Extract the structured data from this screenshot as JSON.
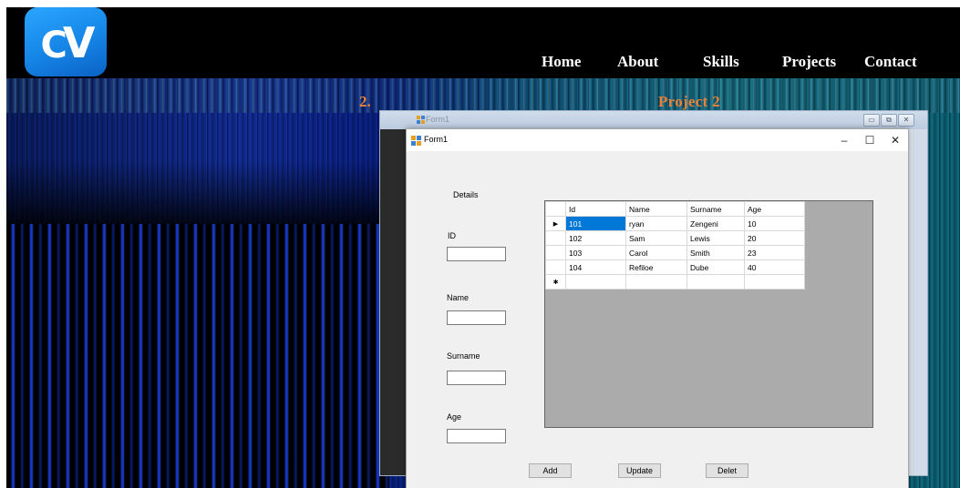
{
  "logo": {
    "letter1": "C",
    "letter2": "V"
  },
  "nav": {
    "home": "Home",
    "about": "About",
    "skills": "Skills",
    "projects": "Projects",
    "contact": "Contact"
  },
  "section": {
    "number": "2.",
    "title": "Project 2"
  },
  "back_window": {
    "title": "Form1"
  },
  "form": {
    "title": "Form1",
    "window_buttons": {
      "minimize": "–",
      "maximize": "☐",
      "close": "✕"
    },
    "details_label": "Details",
    "fields": {
      "id_label": "ID",
      "name_label": "Name",
      "surname_label": "Surname",
      "age_label": "Age"
    },
    "buttons": {
      "add": "Add",
      "update": "Update",
      "delete": "Delet"
    },
    "grid": {
      "columns": [
        "Id",
        "Name",
        "Surname",
        "Age"
      ],
      "rows": [
        [
          "101",
          "ryan",
          "Zengeni",
          "10"
        ],
        [
          "102",
          "Sam",
          "Lewis",
          "20"
        ],
        [
          "103",
          "Carol",
          "Smith",
          "23"
        ],
        [
          "104",
          "Refiloe",
          "Dube",
          "40"
        ]
      ],
      "current_row_marker": "▶",
      "new_row_marker": "✱"
    }
  },
  "colors": {
    "accent_orange": "#e8823a",
    "selection_blue": "#0078d7",
    "logo_blue": "#1585e6"
  }
}
